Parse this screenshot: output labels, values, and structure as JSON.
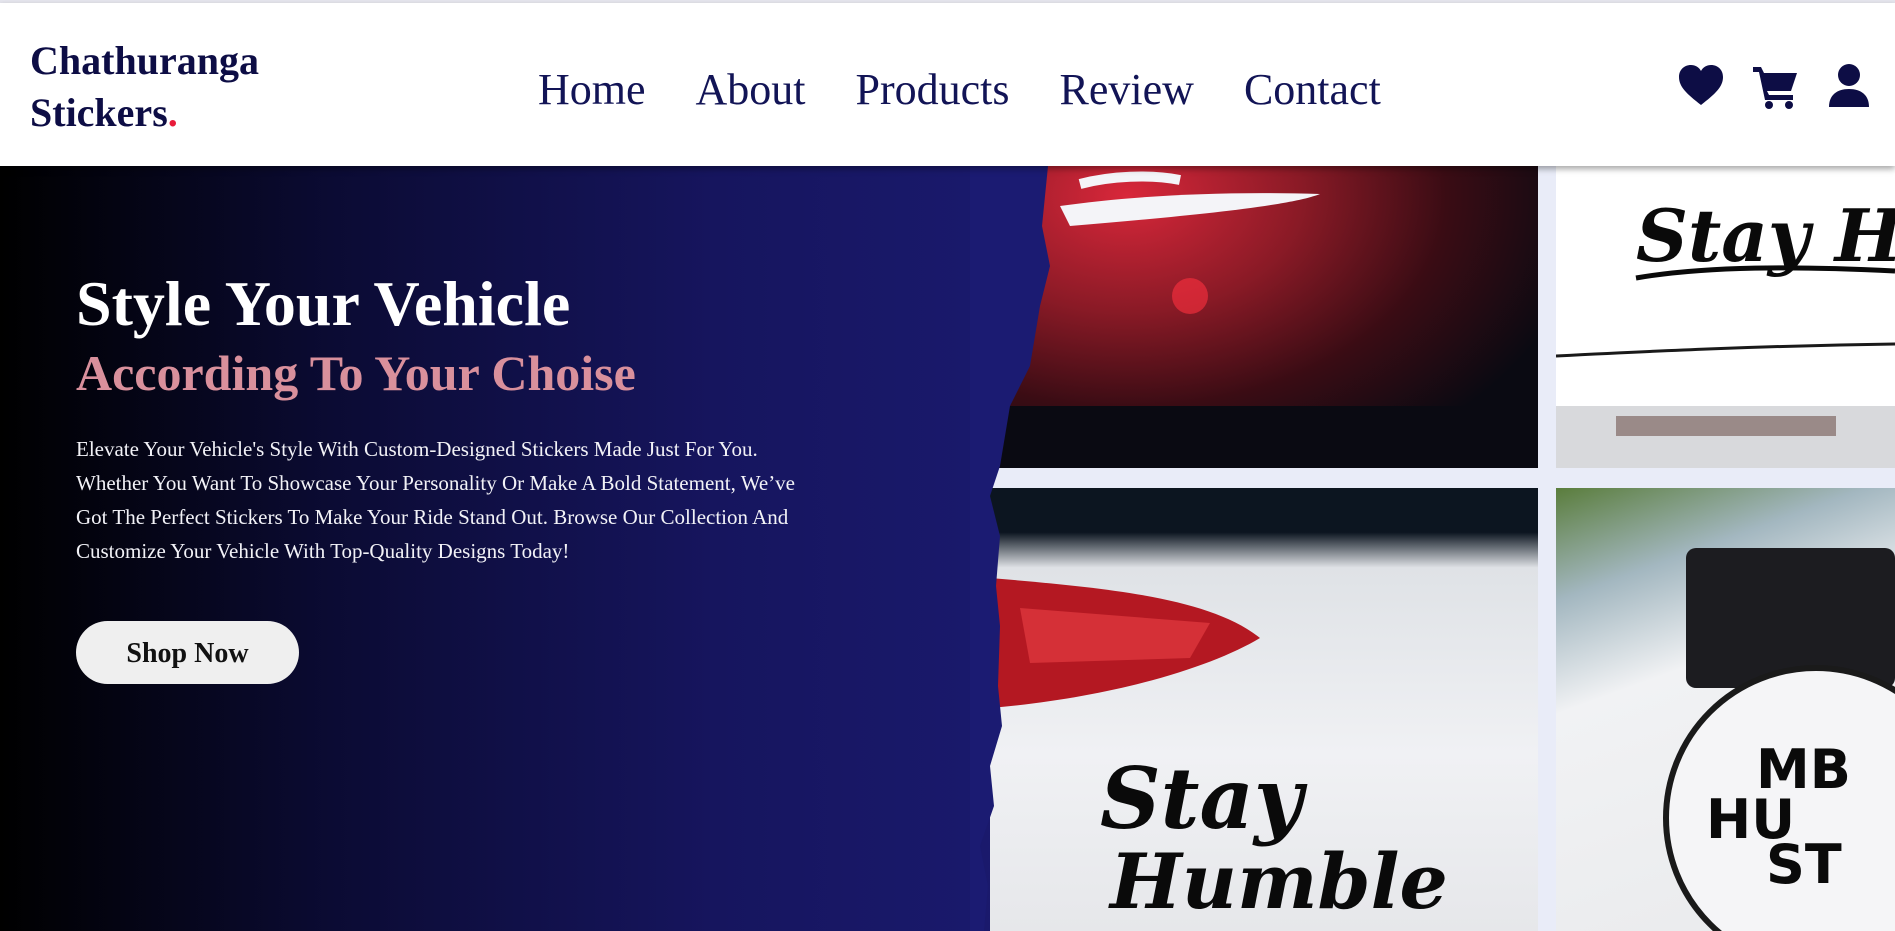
{
  "logo": {
    "line1": "Chathuranga",
    "line2": "Stickers",
    "dot": "."
  },
  "nav": {
    "home": "Home",
    "about": "About",
    "products": "Products",
    "review": "Review",
    "contact": "Contact"
  },
  "icons": [
    "heart-icon",
    "cart-icon",
    "user-icon"
  ],
  "hero": {
    "title": "Style Your Vehicle",
    "subtitle": "According To Your Choise",
    "description": "Elevate Your Vehicle's Style With Custom-Designed Stickers Made Just For You. Whether You Want To Showcase Your Personality Or Make A Bold Statement, We’ve Got The Perfect Stickers To Make Your Ride Stand Out. Browse Our Collection And Customize Your Vehicle With Top-Quality Designs Today!",
    "button": "Shop Now"
  },
  "colors": {
    "navy": "#121456",
    "accent_red": "#e81b3a",
    "subtitle_pink": "#d9909c",
    "hero_dark": "#1b1b72"
  }
}
